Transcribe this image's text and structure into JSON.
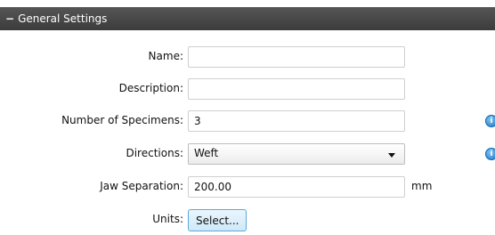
{
  "panel": {
    "collapse_symbol": "−",
    "title": "General Settings"
  },
  "fields": {
    "name": {
      "label": "Name:",
      "value": ""
    },
    "description": {
      "label": "Description:",
      "value": ""
    },
    "number_of_specimens": {
      "label": "Number of Specimens:",
      "value": "3"
    },
    "directions": {
      "label": "Directions:",
      "selected": "Weft"
    },
    "jaw_separation": {
      "label": "Jaw Separation:",
      "value": "200.00",
      "unit": "mm"
    },
    "units": {
      "label": "Units:",
      "button": "Select..."
    }
  },
  "icons": {
    "specimens_info": "info-icon",
    "directions_info": "info-icon"
  },
  "colors": {
    "header_bg": "#444444",
    "button_border": "#5aa9dd",
    "info_icon": "#1e78c8"
  }
}
